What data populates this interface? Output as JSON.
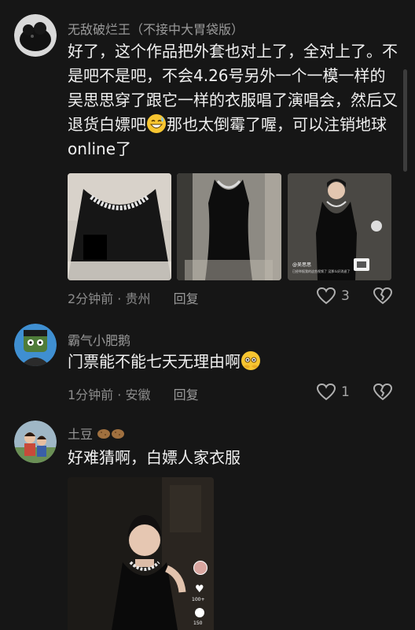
{
  "comments": [
    {
      "username": "无敌破烂王（不接中大胃袋版）",
      "text_part1": "好了，这个作品把外套也对上了，全对上了。不是吧不是吧，不会4.26号另外一个一模一样的吴思思穿了跟它一样的衣服唱了演唱会，然后又退货白嫖吧",
      "emoji": "grinning-sweat-emoji",
      "text_part2": "那也太倒霉了喔，可以注销地球online了",
      "images": [
        {
          "name": "photo-necklace-closeup"
        },
        {
          "name": "photo-dress-front"
        },
        {
          "name": "photo-dress-screenshot",
          "overlay_text": "@吴思思",
          "overlay_sub": "已经举报我的这些视频了 没那么好消退了"
        }
      ],
      "time": "2分钟前",
      "location": "贵州",
      "reply_label": "回复",
      "like_count": "3"
    },
    {
      "username": "霸气小肥鹅",
      "text": "门票能不能七天无理由啊",
      "emoji": "peeking-face-emoji",
      "time": "1分钟前",
      "location": "安徽",
      "reply_label": "回复",
      "like_count": "1"
    },
    {
      "username": "土豆",
      "username_suffix": "potato-emoji",
      "text": "好难猜啊，白嫖人家衣服",
      "image": {
        "name": "photo-woman-black-dress",
        "side_counts": [
          "100+",
          "150"
        ]
      }
    }
  ],
  "colors": {
    "background": "#161616",
    "text": "#f0f0f0",
    "muted": "#8c8c8c"
  }
}
